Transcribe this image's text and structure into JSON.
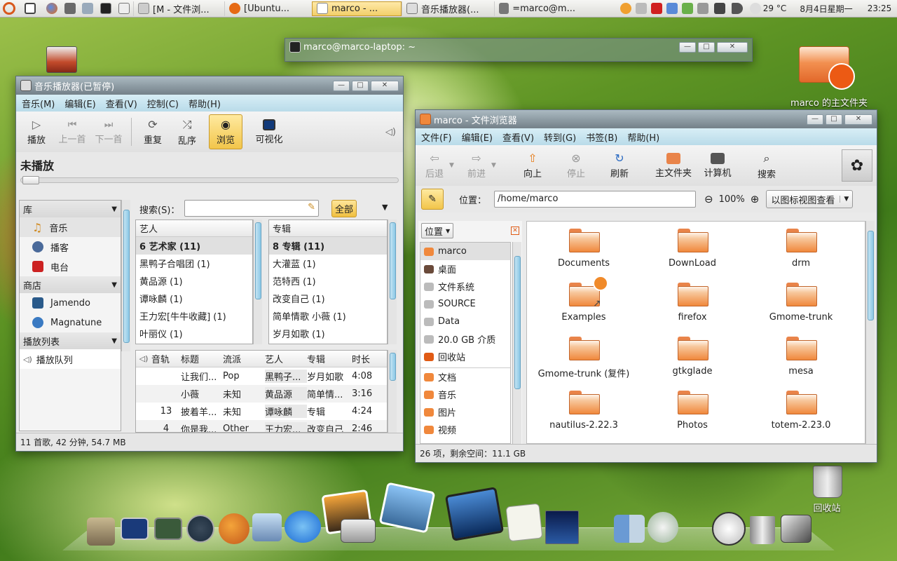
{
  "top_panel": {
    "tasks": [
      {
        "label": "[M - 文件浏..."
      },
      {
        "label": "[Ubuntu..."
      },
      {
        "label": "marco - ..."
      },
      {
        "label": "音乐播放器(..."
      },
      {
        "label": "=marco@m..."
      }
    ],
    "weather": "29 °C",
    "date": "8月4日星期一",
    "time": "23:25"
  },
  "desktop": {
    "home_label": "marco 的主文件夹",
    "trash_label": "回收站"
  },
  "terminal": {
    "title": "marco@marco-laptop: ~"
  },
  "music": {
    "title": "音乐播放器(已暂停)",
    "menu": [
      "音乐(M)",
      "编辑(E)",
      "查看(V)",
      "控制(C)",
      "帮助(H)"
    ],
    "toolbar": [
      {
        "label": "播放",
        "enabled": true
      },
      {
        "label": "上一首",
        "enabled": false
      },
      {
        "label": "下一首",
        "enabled": false
      },
      {
        "label": "重复",
        "enabled": true
      },
      {
        "label": "乱序",
        "enabled": true
      },
      {
        "label": "浏览",
        "enabled": true,
        "active": true
      },
      {
        "label": "可视化",
        "enabled": true
      }
    ],
    "now_playing": "未播放",
    "library_header": "库",
    "library": [
      "音乐",
      "播客",
      "电台"
    ],
    "store_header": "商店",
    "store": [
      "Jamendo",
      "Magnatune"
    ],
    "playlist_header": "播放列表",
    "playlist": [
      "播放队列"
    ],
    "search_label": "搜索(S)：",
    "search_value": "",
    "filter_button": "全部",
    "artist_header": "艺人",
    "artists": [
      "6 艺术家 (11)",
      "黑鸭子合唱团 (1)",
      "黄品源 (1)",
      "谭咏麟 (1)",
      "王力宏[牛牛收藏] (1)",
      "叶丽仪 (1)"
    ],
    "album_header": "专辑",
    "albums": [
      "8 专辑 (11)",
      "大灌蓝 (1)",
      "范特西 (1)",
      "改变自己 (1)",
      "简单情歌 小薇 (1)",
      "岁月如歌 (1)"
    ],
    "track_columns": [
      "音轨",
      "标题",
      "流派",
      "艺人",
      "专辑",
      "时长"
    ],
    "tracks": [
      [
        "",
        "让我们...",
        "Pop",
        "黑鸭子...",
        "岁月如歌",
        "4:08"
      ],
      [
        "",
        "小薇",
        "未知",
        "黄品源",
        "简单情...",
        "3:16"
      ],
      [
        "13",
        "披着羊...",
        "未知",
        "谭咏麟",
        "专辑",
        "4:24"
      ],
      [
        "4",
        "你是我...",
        "Other",
        "王力宏...",
        "改变自己",
        "2:46"
      ]
    ],
    "status": "11 首歌, 42 分钟, 54.7 MB"
  },
  "fm": {
    "title": "marco - 文件浏览器",
    "menu": [
      "文件(F)",
      "编辑(E)",
      "查看(V)",
      "转到(G)",
      "书签(B)",
      "帮助(H)"
    ],
    "toolbar": [
      {
        "label": "后退",
        "enabled": false
      },
      {
        "label": "前进",
        "enabled": false
      },
      {
        "label": "向上",
        "enabled": true
      },
      {
        "label": "停止",
        "enabled": false
      },
      {
        "label": "刷新",
        "enabled": true
      },
      {
        "label": "主文件夹",
        "enabled": true
      },
      {
        "label": "计算机",
        "enabled": true
      },
      {
        "label": "搜索",
        "enabled": true
      }
    ],
    "location_label": "位置：",
    "location": "/home/marco",
    "zoom": "100%",
    "view_mode": "以图标视图查看",
    "side_selector": "位置",
    "places": [
      "marco",
      "桌面",
      "文件系统",
      "SOURCE",
      "Data",
      "20.0 GB 介质",
      "回收站"
    ],
    "bookmarks": [
      "文档",
      "音乐",
      "图片",
      "视频"
    ],
    "files": [
      "Documents",
      "DownLoad",
      "drm",
      "Examples",
      "firefox",
      "Gmome-trunk",
      "Gmome-trunk (复件)",
      "gtkglade",
      "mesa",
      "nautilus-2.22.3",
      "Photos",
      "totem-2.23.0"
    ],
    "status": "26 项，剩余空间：11.1 GB"
  }
}
